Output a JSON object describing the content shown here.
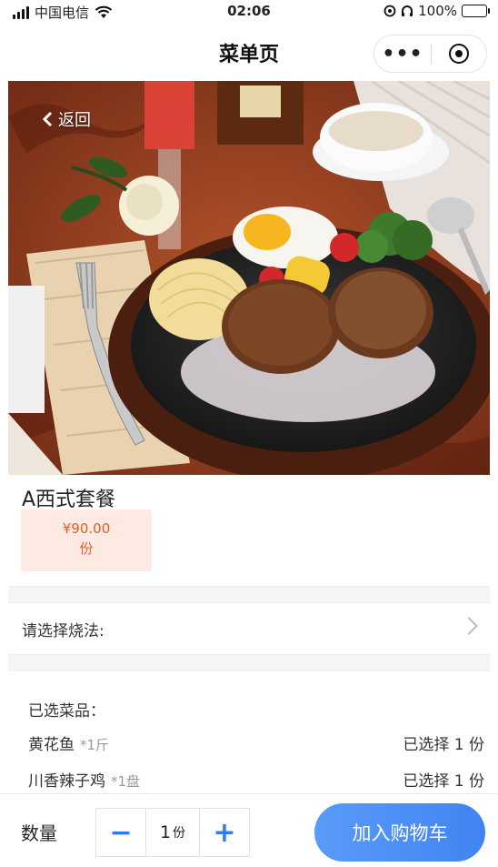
{
  "status_bar": {
    "carrier": "中国电信",
    "time": "02:06",
    "battery": "100%"
  },
  "nav": {
    "title": "菜单页",
    "more_glyph": "•••"
  },
  "hero": {
    "back_label": "返回"
  },
  "product": {
    "name": "A西式套餐",
    "price": "¥90.00",
    "unit": "份"
  },
  "cooking": {
    "label": "请选择烧法:"
  },
  "selected": {
    "title": "已选菜品：",
    "items": [
      {
        "name": "黄花鱼",
        "qty": "*1斤",
        "status": "已选择 1 份"
      },
      {
        "name": "川香辣子鸡",
        "qty": "*1盘",
        "status": "已选择 1 份"
      }
    ]
  },
  "bottom": {
    "quantity_label": "数量",
    "minus": "−",
    "plus": "+",
    "quantity_value": "1",
    "quantity_unit": "份",
    "add_to_cart": "加入购物车"
  }
}
